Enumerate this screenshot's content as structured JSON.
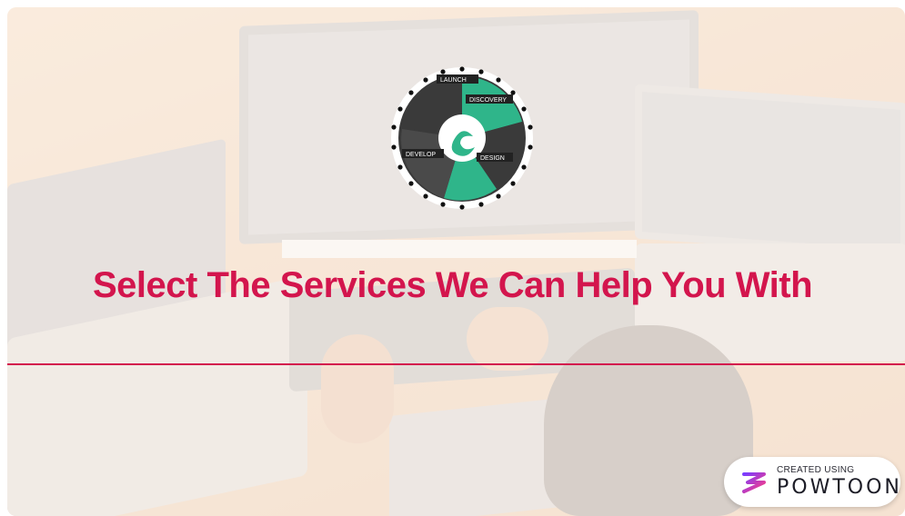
{
  "slide": {
    "headline": "Select The Services We Can Help You With",
    "accent_color": "#d3154d"
  },
  "logo": {
    "segments": [
      "LAUNCH",
      "DISCOVERY",
      "DEVELOP",
      "DESIGN"
    ],
    "colors": {
      "dark": "#3a3a3a",
      "teal": "#2fb58a"
    }
  },
  "watermark": {
    "small_text": "CREATED USING",
    "brand_text": "POWTOON",
    "icon": "powtoon-logo-icon"
  }
}
